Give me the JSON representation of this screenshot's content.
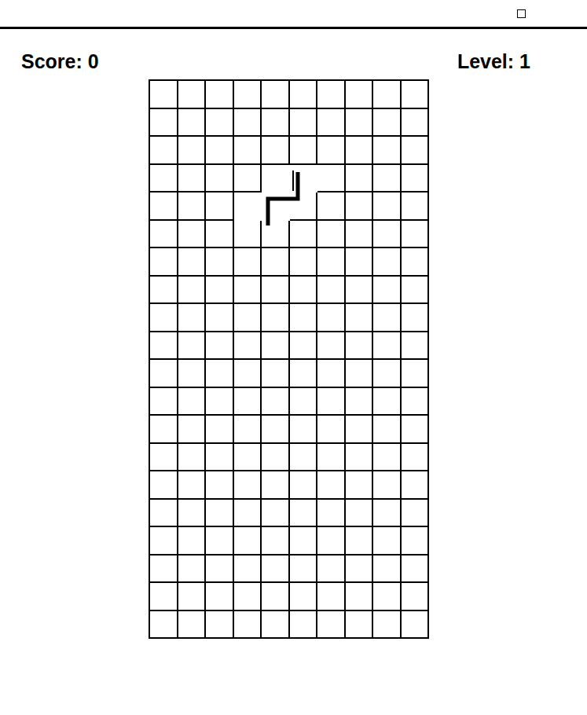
{
  "score": "Score: 0",
  "level": "Level: 1",
  "board": {
    "rows": 20,
    "columns": 10
  },
  "piece": {
    "cells": [
      {
        "row": 3,
        "col": 4
      },
      {
        "row": 3,
        "col": 5
      },
      {
        "row": 4,
        "col": 3
      },
      {
        "row": 4,
        "col": 4
      }
    ]
  }
}
